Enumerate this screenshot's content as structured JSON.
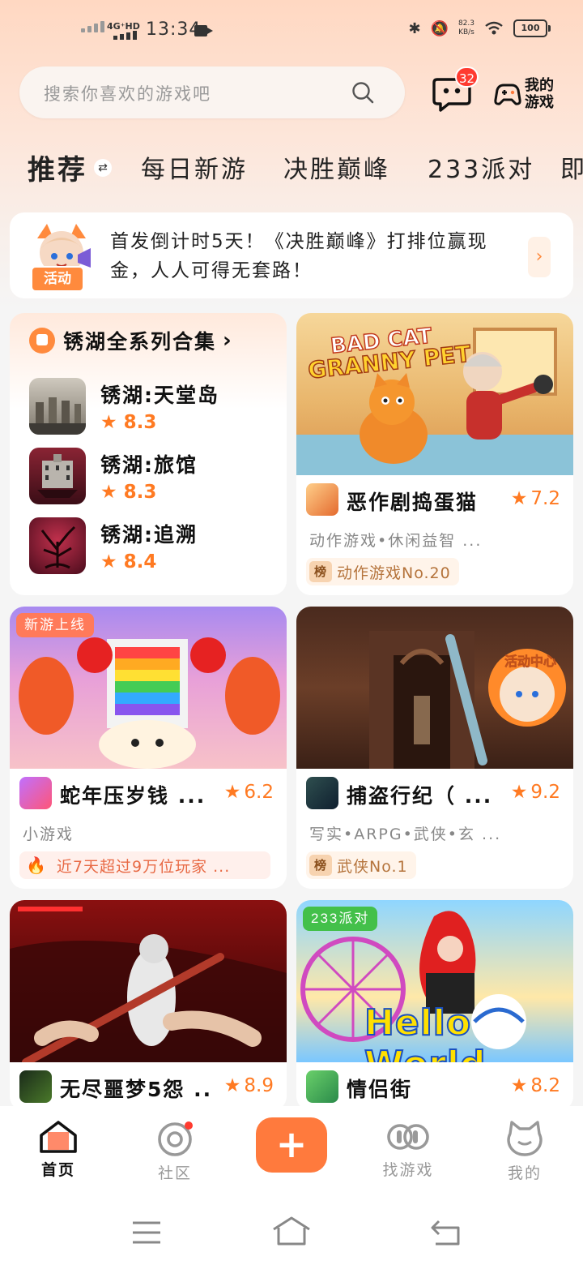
{
  "status_bar": {
    "network": "4G⁺HD",
    "time": "13:34",
    "speed_value": "82.3",
    "speed_unit": "KB/s",
    "battery": "100"
  },
  "search": {
    "placeholder": "搜索你喜欢的游戏吧"
  },
  "header": {
    "message_badge": "32",
    "my_games_line1": "我的",
    "my_games_line2": "游戏"
  },
  "tabs": [
    {
      "label": "推荐",
      "active": true
    },
    {
      "label": "每日新游"
    },
    {
      "label": "决胜巅峰"
    },
    {
      "label": "233派对"
    },
    {
      "label": "即"
    }
  ],
  "notice": {
    "tag": "活动",
    "text": "首发倒计时5天！《决胜巅峰》打排位赢现金，人人可得无套路！"
  },
  "collection": {
    "title": "锈湖全系列合集",
    "items": [
      {
        "name": "锈湖:天堂岛",
        "rating": "8.3"
      },
      {
        "name": "锈湖:旅馆",
        "rating": "8.3"
      },
      {
        "name": "锈湖:追溯",
        "rating": "8.4"
      }
    ]
  },
  "games": [
    {
      "name": "恶作剧捣蛋猫",
      "rating": "7.2",
      "tags": "动作游戏•休闲益智 ...",
      "chip_badge": "榜",
      "chip": "动作游戏No.20",
      "cover_title_1": "BAD CAT",
      "cover_title_2": "GRANNY PET"
    },
    {
      "name": "蛇年压岁钱 ...",
      "rating": "6.2",
      "tags": "小游戏",
      "chip": "近7天超过9万位玩家 ...",
      "cover_tag": "新游上线"
    },
    {
      "name": "捕盗行纪（ ...",
      "rating": "9.2",
      "tags": "写实•ARPG•武侠•玄 ...",
      "chip_badge": "榜",
      "chip": "武侠No.1",
      "cover_badge": "活动中心"
    },
    {
      "name": "无尽噩梦5怨 ...",
      "rating": "8.9"
    },
    {
      "name": "情侣街",
      "rating": "8.2",
      "cover_tag": "233派对",
      "cover_title": "Hello World"
    }
  ],
  "bottom_nav": [
    {
      "label": "首页",
      "active": true
    },
    {
      "label": "社区"
    },
    {
      "label": "找游戏"
    },
    {
      "label": "我的"
    }
  ],
  "colors": {
    "accent": "#ff7a3d",
    "rating": "#ff7a22",
    "badge": "#ff3b30"
  }
}
